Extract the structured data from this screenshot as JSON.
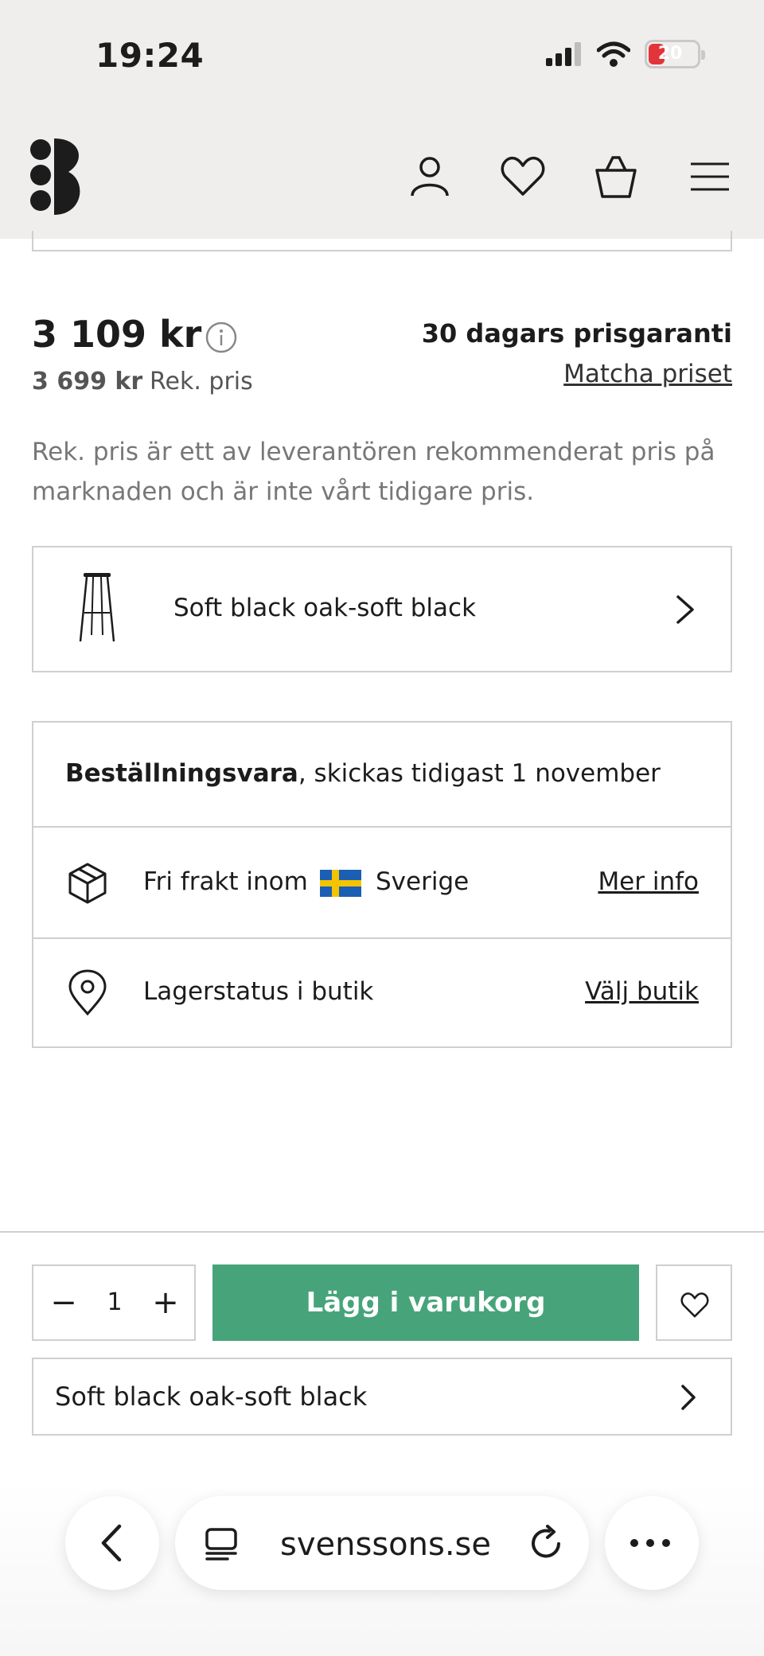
{
  "status_bar": {
    "time": "19:24",
    "battery_level": "20",
    "icons": [
      "cellular-signal-icon",
      "wifi-icon",
      "battery-charging-icon"
    ]
  },
  "header": {
    "logo": "svenssons-s-logo",
    "icons": [
      "user-icon",
      "heart-icon",
      "shopping-bag-icon",
      "menu-icon"
    ]
  },
  "price": {
    "current": "3 109 kr",
    "recommended": "3 699 kr",
    "recommended_label": "Rek. pris",
    "guarantee": "30 dagars prisgaranti",
    "match_link": "Matcha priset",
    "note": "Rek. pris är ett av leverantören rekommenderat pris på marknaden och är inte vårt tidigare pris."
  },
  "variant": {
    "label": "Soft black oak-soft black",
    "thumb_icon": "bar-stool-icon"
  },
  "shipping": {
    "order_bold": "Beställningsvara",
    "order_rest": ", skickas tidigast 1 november",
    "free_shipping": "Fri frakt inom",
    "country": "Sverige",
    "more_info": "Mer info",
    "stock_status": "Lagerstatus i butik",
    "choose_store": "Välj butik"
  },
  "cart": {
    "quantity": "1",
    "add_to_cart": "Lägg i varukorg",
    "button_color": "#47a47a"
  },
  "bottom_variant": {
    "label": "Soft black oak-soft black"
  },
  "browser": {
    "url": "svenssons.se"
  }
}
